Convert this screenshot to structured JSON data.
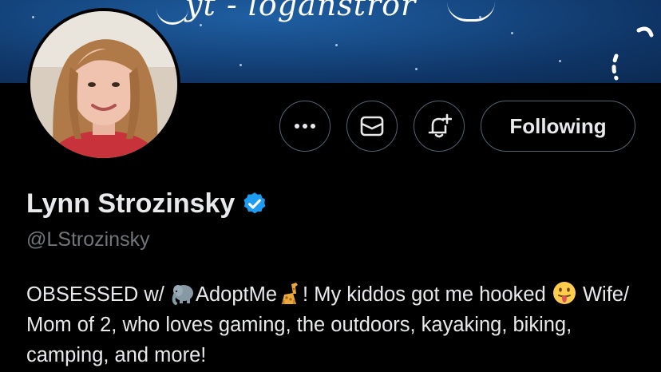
{
  "banner": {
    "text": "yt - loganstror",
    "colors": {
      "dark": "#0b2a52",
      "mid": "#174b86",
      "light": "#1f5fa3"
    }
  },
  "profile": {
    "avatar_icon": "profile-photo",
    "display_name": "Lynn Strozinsky",
    "verified": true,
    "handle": "@LStrozinsky"
  },
  "actions": {
    "more_icon": "more-dots-icon",
    "message_icon": "envelope-icon",
    "notify_icon": "bell-plus-icon",
    "follow_label": "Following"
  },
  "bio": {
    "part1": "OBSESSED w/ ",
    "emoji1": "elephant-emoji",
    "part2": "AdoptMe",
    "emoji2": "giraffe-emoji",
    "part3": "! My kiddos got me hooked ",
    "emoji3": "tongue-face-emoji",
    "part4": " Wife/ Mom of 2, who loves gaming, the outdoors, kayaking, biking, camping, and more!"
  },
  "colors": {
    "background": "#000000",
    "text": "#e7e9ea",
    "muted": "#71767b",
    "border": "#536471",
    "verified": "#1d9bf0"
  }
}
